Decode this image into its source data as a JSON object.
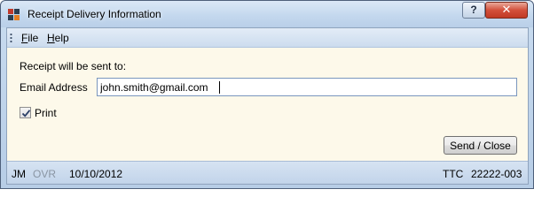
{
  "window": {
    "title": "Receipt Delivery Information",
    "help_button": "?",
    "close_button": "✕"
  },
  "menu": {
    "file": "File",
    "file_mnemonic": "F",
    "file_rest": "ile",
    "help": "Help",
    "help_mnemonic": "H",
    "help_rest": "elp"
  },
  "form": {
    "intro_label": "Receipt will be sent to:",
    "email_label": "Email Address",
    "email_value": "john.smith@gmail.com",
    "print_label": "Print",
    "print_checked": true,
    "send_button": "Send / Close"
  },
  "status": {
    "user": "JM",
    "mode": "OVR",
    "date": "10/10/2012",
    "ttc": "TTC",
    "id": "22222-003"
  },
  "colors": {
    "client_bg": "#fdf9ea",
    "frame": "#c9dcf0",
    "close_red": "#c13a24"
  }
}
